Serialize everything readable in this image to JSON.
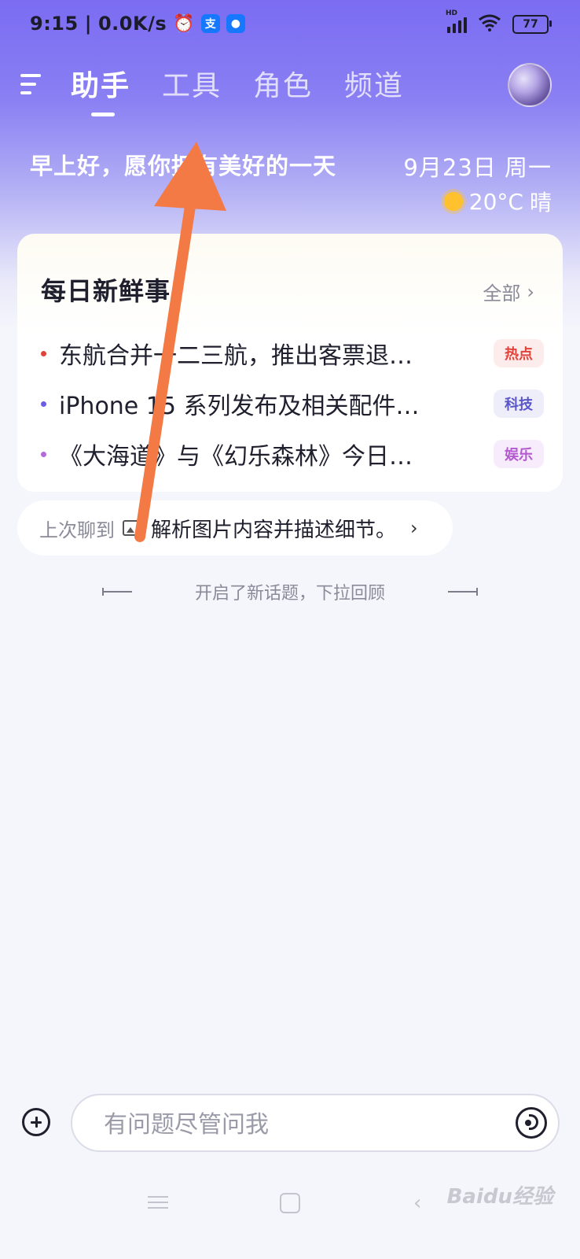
{
  "status_bar": {
    "time": "9:15",
    "speed": "0.0K/s",
    "alipay_glyph": "支",
    "battery": "77",
    "hd": "HD"
  },
  "nav": {
    "tabs": [
      {
        "label": "助手",
        "active": true
      },
      {
        "label": "工具"
      },
      {
        "label": "角色"
      },
      {
        "label": "频道"
      }
    ]
  },
  "header": {
    "greeting": "早上好，愿你拥有美好的一天",
    "date": "9月23日 周一",
    "temperature": "20°C",
    "condition": "晴"
  },
  "news": {
    "title": "每日新鲜事",
    "see_all": "全部",
    "items": [
      {
        "text": "东航合并一二三航，推出客票退…",
        "tag": "热点",
        "dot_color": "#e0433a",
        "tag_color": "#e0433a",
        "tag_bg": "#fdecec"
      },
      {
        "text": "iPhone 15 系列发布及相关配件…",
        "tag": "科技",
        "dot_color": "#6b5ee0",
        "tag_color": "#5b57c8",
        "tag_bg": "#eeeefb"
      },
      {
        "text": "《大海道》与《幻乐森林》今日…",
        "tag": "娱乐",
        "dot_color": "#b26bd9",
        "tag_color": "#b45ad1",
        "tag_bg": "#f6ecfb"
      }
    ]
  },
  "last_chat": {
    "label": "上次聊到",
    "text": "解析图片内容并描述细节。",
    "chevron": "›"
  },
  "divider": {
    "text": "开启了新话题，下拉回顾"
  },
  "input": {
    "placeholder": "有问题尽管问我"
  },
  "watermark": "Baidu经验",
  "colors": {
    "accent": "#7b6cf2",
    "arrow": "#f47a45"
  }
}
